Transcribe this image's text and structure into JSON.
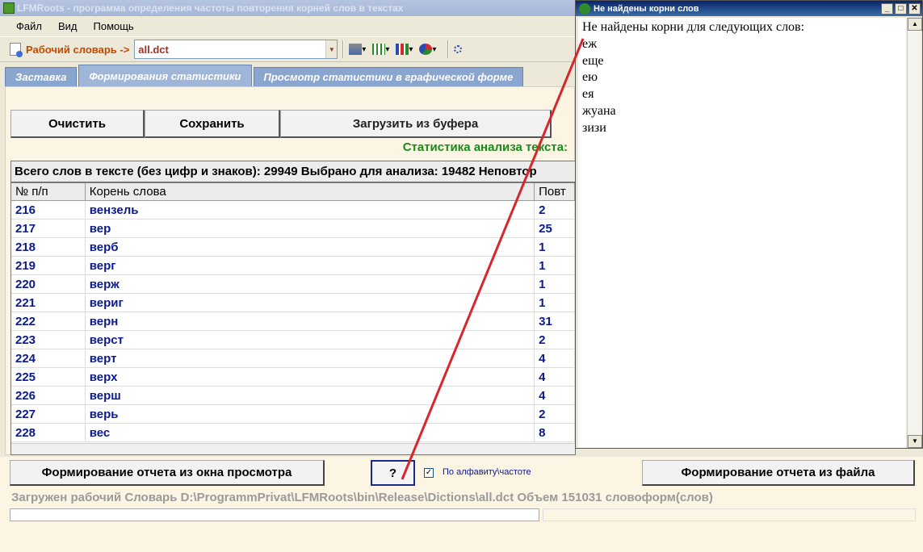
{
  "window": {
    "title": "LFMRoots - программа определения частоты повторения корней слов в текстах"
  },
  "menu": [
    "Файл",
    "Вид",
    "Помощь"
  ],
  "toolbar": {
    "dict_label": "Рабочий словарь ->",
    "dict_value": "all.dct"
  },
  "tabs": [
    "Заставка",
    "Формирования статистики",
    "Просмотр статистики в графической форме"
  ],
  "buttons": {
    "clear": "Очистить",
    "save": "Сохранить",
    "load": "Загрузить из буфера"
  },
  "stat_title": "Статистика анализа текста:",
  "summary": "Всего слов в тексте (без цифр и знаков): 29949 Выбрано для анализа: 19482 Неповтор",
  "grid": {
    "headers": [
      "№ п/п",
      "Корень слова",
      "Повт"
    ],
    "rows": [
      [
        "216",
        "вензель",
        "2"
      ],
      [
        "217",
        "вер",
        "25"
      ],
      [
        "218",
        "верб",
        "1"
      ],
      [
        "219",
        "верг",
        "1"
      ],
      [
        "220",
        "верж",
        "1"
      ],
      [
        "221",
        "вериг",
        "1"
      ],
      [
        "222",
        "верн",
        "31"
      ],
      [
        "223",
        "верст",
        "2"
      ],
      [
        "224",
        "верт",
        "4"
      ],
      [
        "225",
        "верх",
        "4"
      ],
      [
        "226",
        "верш",
        "4"
      ],
      [
        "227",
        "верь",
        "2"
      ],
      [
        "228",
        "вес",
        "8"
      ]
    ]
  },
  "bottom": {
    "report_view": "Формирование отчета из окна просмотра",
    "help": "?",
    "sort_label": "По алфавиту\\частоте",
    "report_file": "Формирование отчета из файла",
    "status": "Загружен рабочий Словарь D:\\ProgrammPrivat\\LFMRoots\\bin\\Release\\Dictions\\all.dct Объем 151031 словоформ(слов)"
  },
  "popup": {
    "title": "Не найдены корни слов",
    "text": "Не найдены корни для следующих слов:\nеж\nеще\nею\nея\nжуана\nзизи"
  },
  "colors": {
    "annotation_line": "#d9262c",
    "grid_text": "#0b1a8c",
    "stat_title": "#1a8a1a"
  }
}
